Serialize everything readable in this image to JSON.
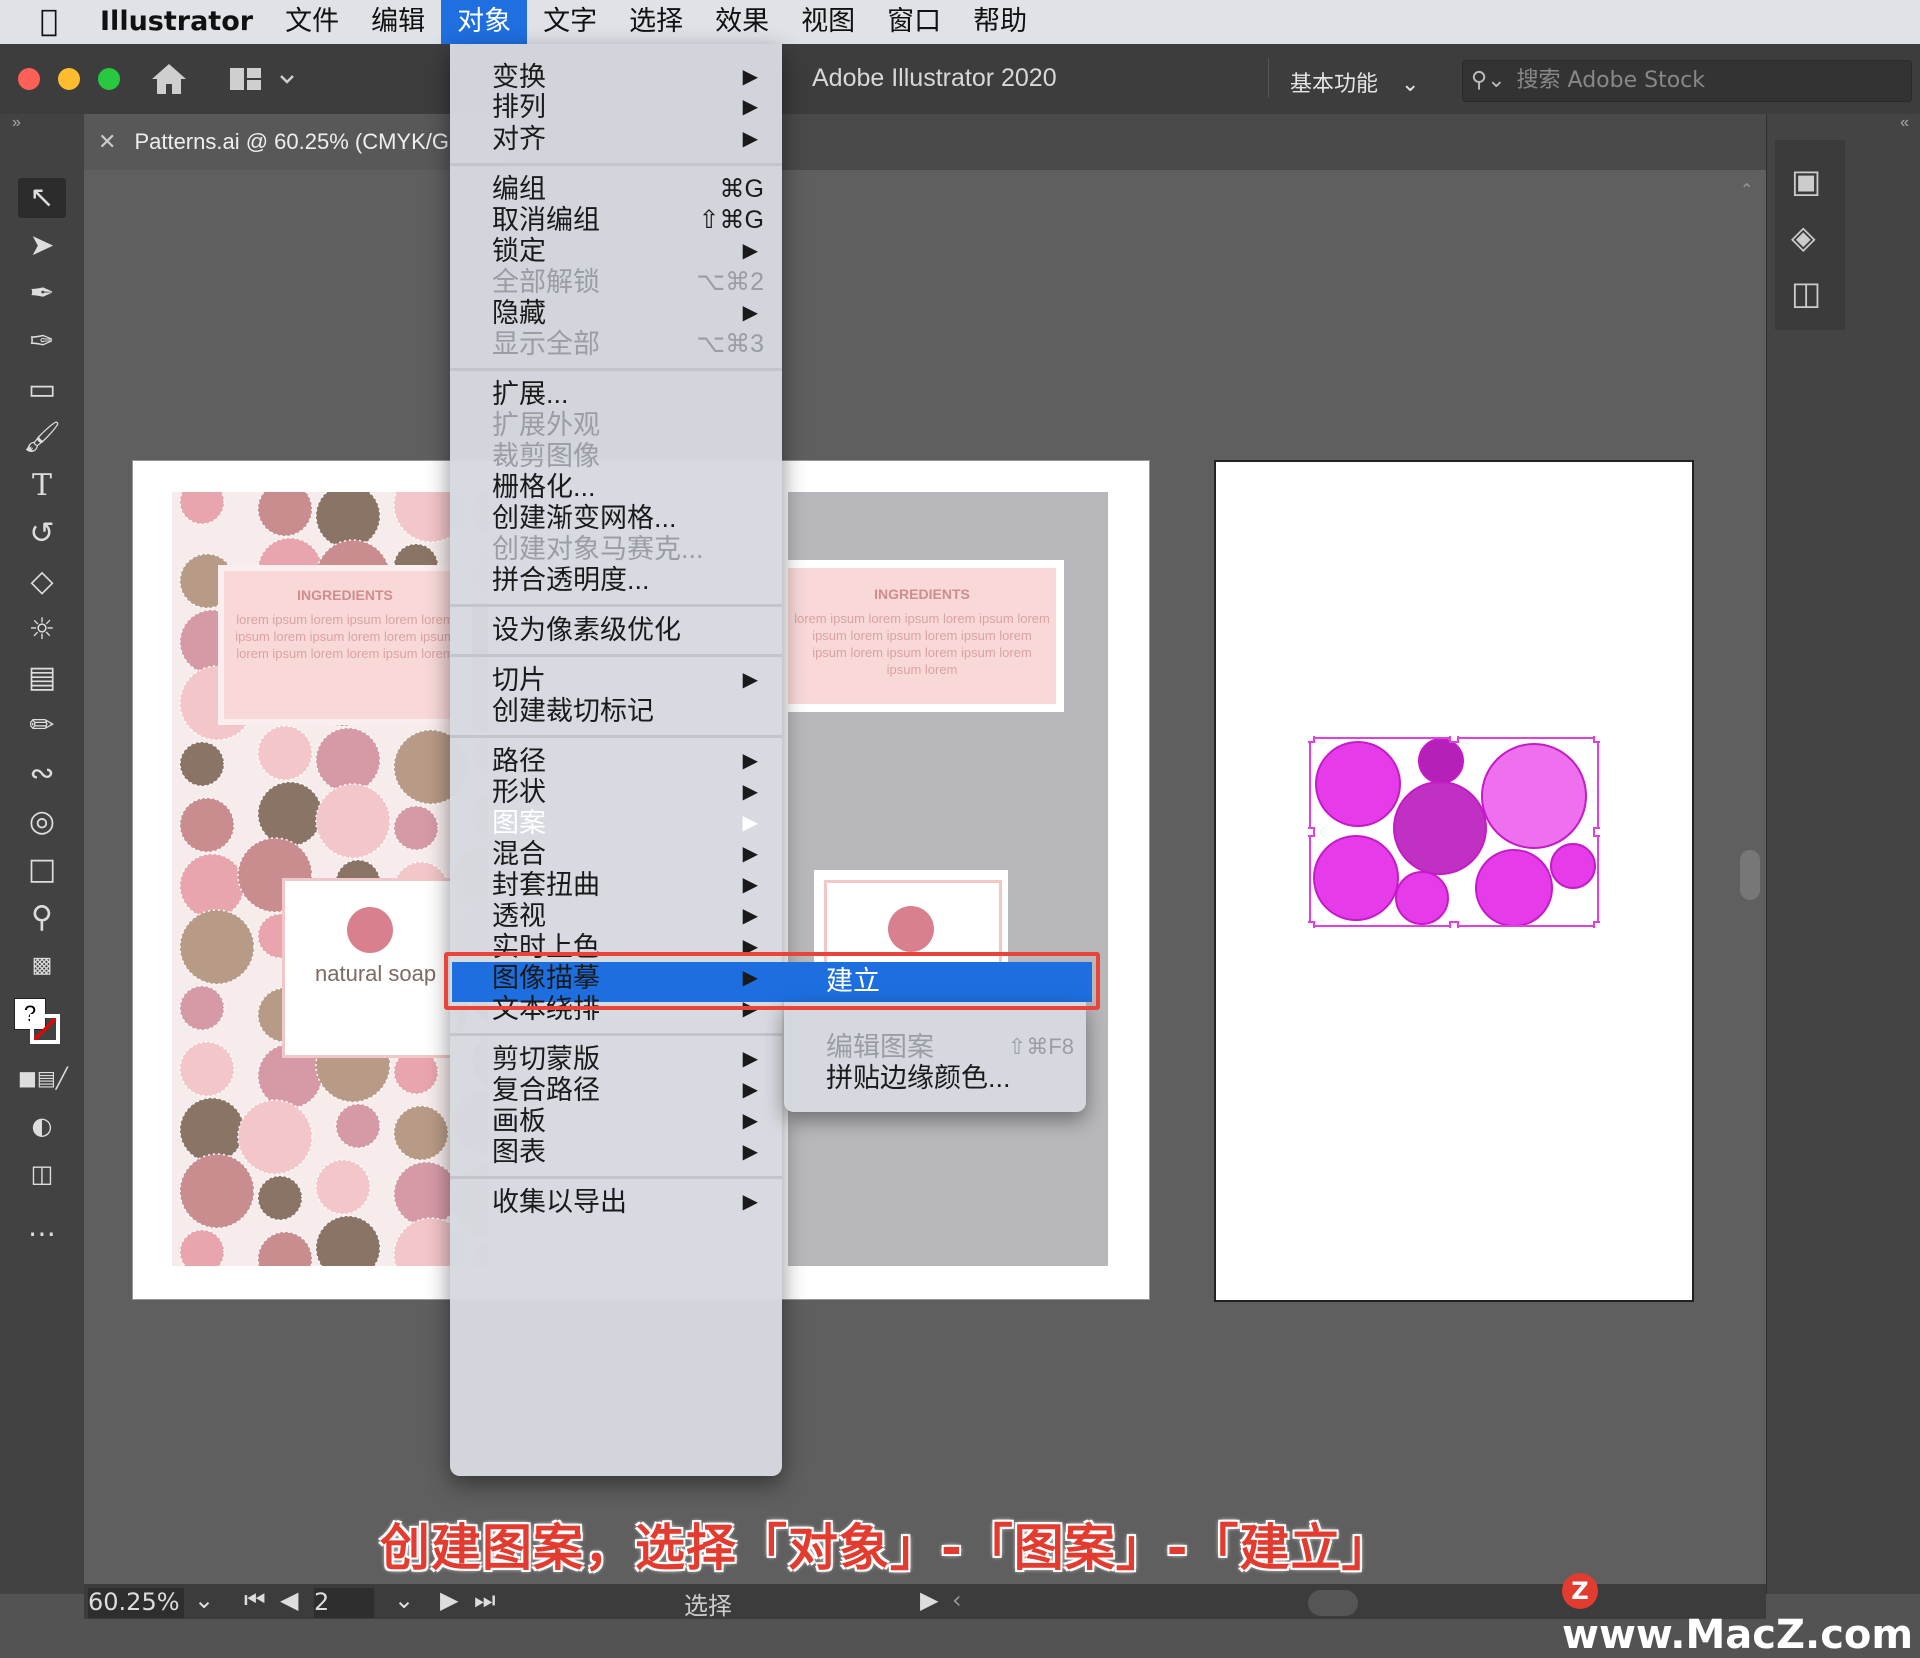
{
  "menubar": {
    "app_name": "Illustrator",
    "items": [
      "文件",
      "编辑",
      "对象",
      "文字",
      "选择",
      "效果",
      "视图",
      "窗口",
      "帮助"
    ],
    "active": "对象"
  },
  "window": {
    "title": "Adobe Illustrator 2020",
    "workspace": "基本功能",
    "search_placeholder": "搜索 Adobe Stock",
    "tab_label": "Patterns.ai @ 60.25% (CMYK/G"
  },
  "object_menu": {
    "groups": [
      [
        {
          "label": "变换",
          "submenu": true
        },
        {
          "label": "排列",
          "submenu": true
        },
        {
          "label": "对齐",
          "submenu": true
        }
      ],
      [
        {
          "label": "编组",
          "shortcut": "⌘G"
        },
        {
          "label": "取消编组",
          "shortcut": "⇧⌘G"
        },
        {
          "label": "锁定",
          "submenu": true
        },
        {
          "label": "全部解锁",
          "shortcut": "⌥⌘2",
          "disabled": true
        },
        {
          "label": "隐藏",
          "submenu": true
        },
        {
          "label": "显示全部",
          "shortcut": "⌥⌘3",
          "disabled": true
        }
      ],
      [
        {
          "label": "扩展..."
        },
        {
          "label": "扩展外观",
          "disabled": true
        },
        {
          "label": "裁剪图像",
          "disabled": true
        },
        {
          "label": "栅格化..."
        },
        {
          "label": "创建渐变网格..."
        },
        {
          "label": "创建对象马赛克...",
          "disabled": true
        },
        {
          "label": "拼合透明度..."
        }
      ],
      [
        {
          "label": "设为像素级优化"
        }
      ],
      [
        {
          "label": "切片",
          "submenu": true
        },
        {
          "label": "创建裁切标记"
        }
      ],
      [
        {
          "label": "路径",
          "submenu": true
        },
        {
          "label": "形状",
          "submenu": true
        },
        {
          "label": "图案",
          "submenu": true,
          "highlighted": true
        },
        {
          "label": "混合",
          "submenu": true
        },
        {
          "label": "封套扭曲",
          "submenu": true
        },
        {
          "label": "透视",
          "submenu": true
        },
        {
          "label": "实时上色",
          "submenu": true
        },
        {
          "label": "图像描摹",
          "submenu": true
        },
        {
          "label": "文本绕排",
          "submenu": true
        }
      ],
      [
        {
          "label": "剪切蒙版",
          "submenu": true
        },
        {
          "label": "复合路径",
          "submenu": true
        },
        {
          "label": "画板",
          "submenu": true
        },
        {
          "label": "图表",
          "submenu": true
        }
      ],
      [
        {
          "label": "收集以导出",
          "submenu": true
        }
      ]
    ]
  },
  "pattern_submenu": {
    "items": [
      {
        "label": "建立",
        "highlighted": true
      },
      {
        "label": "编辑图案",
        "shortcut": "⇧⌘F8",
        "disabled": true
      },
      {
        "label": "拼贴边缘颜色..."
      }
    ]
  },
  "artwork": {
    "ingredients_title": "INGREDIENTS",
    "ingredients_text": "lorem ipsum lorem ipsum lorem ipsum lorem ipsum lorem ipsum lorem ipsum lorem ipsum lorem ipsum lorem ipsum lorem ipsum lorem",
    "ingredients_text_left": "lorem ipsum lorem ipsum lorem lorem ipsum lorem ipsum lorem lorem ipsum lorem ipsum lorem lorem ipsum lorem",
    "brand": "natural soap"
  },
  "statusbar": {
    "zoom": "60.25%",
    "artboard_number": "2",
    "tool_name": "选择"
  },
  "caption": "创建图案，选择「对象」-「图案」-「建立」",
  "watermark": "www.MacZ.com",
  "colors": {
    "accent": "#1d6fe0",
    "highlight_border": "#e8443a",
    "selection": "#e040e0",
    "pattern_pink": "#e8a5ad"
  }
}
